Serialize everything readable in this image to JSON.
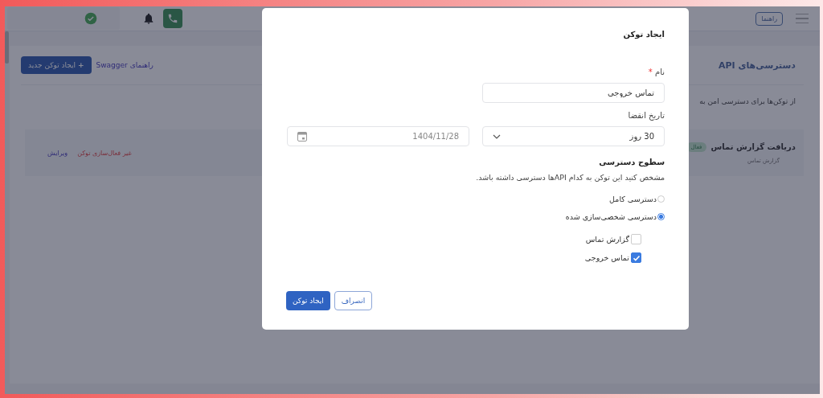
{
  "topbar": {
    "help_button": "راهنما",
    "verified": true
  },
  "panel": {
    "title": "دسترسی‌های API",
    "new_token_button": "ایجاد توکن جدید",
    "new_token_icon": "+",
    "swagger_link": "راهنمای Swagger",
    "description": "از توکن‌ها برای دسترسی امن به"
  },
  "tokens": [
    {
      "name": "دریافت گزارش تماس",
      "badge": "فعال",
      "scope": "گزارش تماس",
      "deactivate": "غیر فعال‌سازی توکن",
      "edit": "ویرایش"
    }
  ],
  "modal": {
    "title": "ایجاد توکن",
    "name_label": "نام",
    "name_required_mark": "*",
    "name_value": "تماس خروجی",
    "expiry_label": "تاریخ انقضا",
    "expiry_option": "30 روز",
    "expiry_date": "1404/11/28",
    "access_title": "سطوح دسترسی",
    "access_hint": "مشخص کنید این توکن به کدام APIها دسترسی داشته باشد.",
    "access_modes": [
      {
        "label": "دسترسی کامل",
        "selected": false
      },
      {
        "label": "دسترسی شخصی‌سازی شده",
        "selected": true
      }
    ],
    "apis": [
      {
        "label": "گزارش تماس",
        "checked": false
      },
      {
        "label": "تماس خروجی",
        "checked": true
      }
    ],
    "submit": "ایجاد توکن",
    "cancel": "انصراف"
  }
}
